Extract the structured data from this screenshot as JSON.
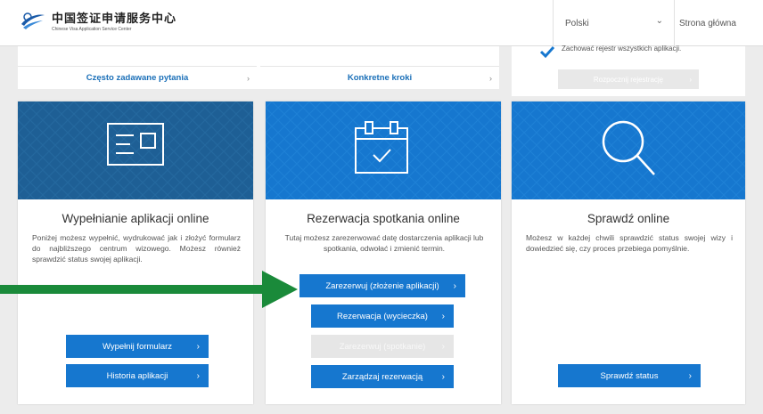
{
  "header": {
    "logo_cn": "中国签证申请服务中心",
    "logo_en": "Chinese Visa Application Service Center",
    "language": "Polski",
    "home_link": "Strona główna"
  },
  "top": {
    "faq_label": "Często zadawane pytania",
    "steps_label": "Konkretne kroki",
    "checkbox_text": "Zachować rejestr wszystkich aplikacji.",
    "disabled_button": "Rozpocznij rejestrację"
  },
  "cards": [
    {
      "title": "Wypełnianie aplikacji online",
      "description": "Poniżej możesz wypełnić, wydrukować jak i złożyć formularz do najbliższego centrum wizowego. Możesz również sprawdzić status swojej aplikacji.",
      "icon": "form-icon",
      "buttons": [
        "Wypełnij formularz",
        "Historia aplikacji"
      ]
    },
    {
      "title": "Rezerwacja spotkania online",
      "description": "Tutaj możesz zarezerwować datę dostarczenia aplikacji lub spotkania, odwołać i zmienić termin.",
      "icon": "calendar-check-icon",
      "buttons": [
        "Zarezerwuj (złożenie aplikacji)",
        "Rezerwacja (wycieczka)",
        "Zarezerwuj (spotkanie)",
        "Zarządzaj rezerwacją"
      ]
    },
    {
      "title": "Sprawdź online",
      "description": "Możesz w każdej chwili sprawdzić status swojej wizy i dowiedzieć się, czy proces przebiega pomyślnie.",
      "icon": "magnifier-icon",
      "buttons": [
        "Sprawdź status"
      ]
    }
  ],
  "colors": {
    "banner_dark": "#1e5f95",
    "banner_bright": "#1677cf",
    "button": "#1677cf",
    "arrow": "#1a8a3a"
  }
}
